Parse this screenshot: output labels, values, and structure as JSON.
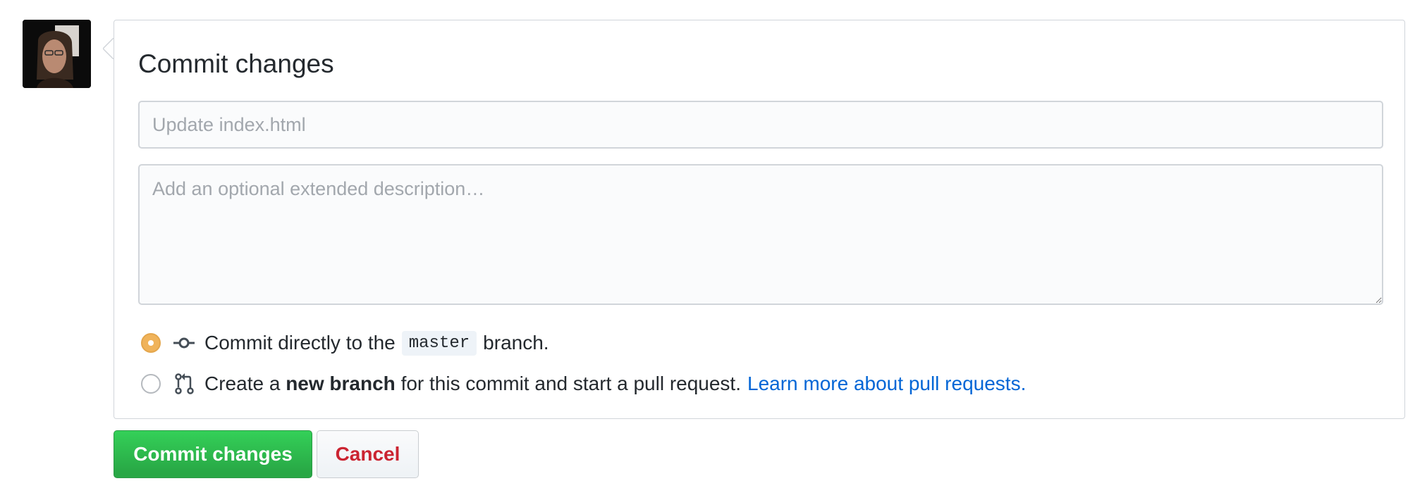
{
  "avatar": {
    "alt": "User avatar"
  },
  "commit_form": {
    "title": "Commit changes",
    "summary_placeholder": "Update index.html",
    "summary_value": "",
    "description_placeholder": "Add an optional extended description…",
    "description_value": "",
    "options": {
      "direct": {
        "selected": true,
        "icon": "git-commit-icon",
        "prefix": "Commit directly to the",
        "branch": "master",
        "suffix": "branch."
      },
      "new_branch": {
        "selected": false,
        "icon": "git-pull-request-icon",
        "prefix": "Create a",
        "bold": "new branch",
        "suffix": "for this commit and start a pull request.",
        "link": "Learn more about pull requests."
      }
    }
  },
  "buttons": {
    "commit_label": "Commit changes",
    "cancel_label": "Cancel"
  },
  "colors": {
    "primary_green": "#28a745",
    "cancel_red": "#cb2431",
    "link_blue": "#0366d6",
    "radio_selected": "#f0b35a"
  }
}
